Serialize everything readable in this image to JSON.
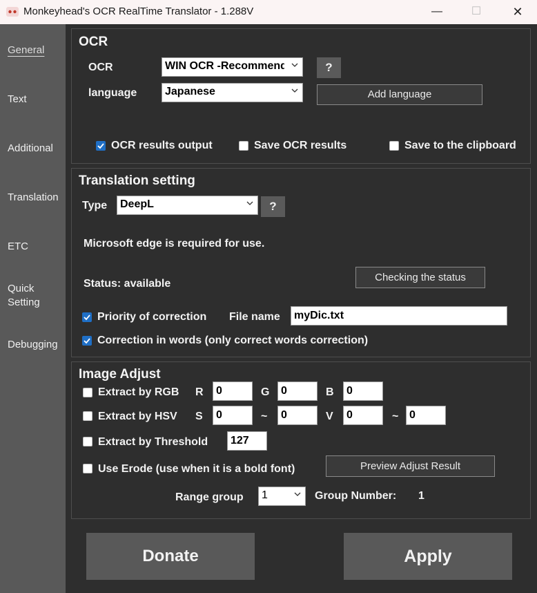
{
  "window": {
    "title": "Monkeyhead's OCR RealTime Translator - 1.288V",
    "minimize": "—",
    "maximize": "☐",
    "close": "✕"
  },
  "sidebar": {
    "items": [
      {
        "label": "General",
        "active": true
      },
      {
        "label": "Text"
      },
      {
        "label": "Additional"
      },
      {
        "label": "Translation"
      },
      {
        "label": "ETC"
      },
      {
        "label": "Quick\nSetting"
      },
      {
        "label": "Debugging"
      }
    ]
  },
  "ocr": {
    "heading": "OCR",
    "ocr_label": "OCR",
    "ocr_value": "WIN OCR -Recommended",
    "help": "?",
    "language_label": "language",
    "language_value": "Japanese",
    "add_language": "Add language",
    "results_output": "OCR results output",
    "save_results": "Save OCR results",
    "save_clipboard": "Save to the clipboard",
    "results_output_checked": true,
    "save_results_checked": false,
    "save_clipboard_checked": false
  },
  "translation": {
    "heading": "Translation setting",
    "type_label": "Type",
    "type_value": "DeepL",
    "help": "?",
    "edge_note": "Microsoft edge is required for use.",
    "status": "Status: available",
    "check_status": "Checking the status",
    "priority": "Priority of correction",
    "priority_checked": true,
    "file_label": "File name",
    "file_value": "myDic.txt",
    "correction_words": "Correction in words (only correct words correction)",
    "correction_words_checked": true
  },
  "image_adjust": {
    "heading": "Image Adjust",
    "rgb_label": "Extract by RGB",
    "r_label": "R",
    "r_value": "0",
    "g_label": "G",
    "g_value": "0",
    "b_label": "B",
    "b_value": "0",
    "hsv_label": "Extract by HSV",
    "s_label": "S",
    "s_from": "0",
    "tilde1": "~",
    "s_to": "0",
    "v_label": "V",
    "v_from": "0",
    "tilde2": "~",
    "v_to": "0",
    "threshold_label": "Extract by Threshold",
    "threshold_value": "127",
    "erode_label": "Use Erode (use when it is a bold font)",
    "preview": "Preview Adjust Result",
    "range_group_label": "Range group",
    "range_group_value": "1",
    "group_number_label": "Group Number:",
    "group_number_value": "1"
  },
  "footer": {
    "donate": "Donate",
    "apply": "Apply"
  }
}
